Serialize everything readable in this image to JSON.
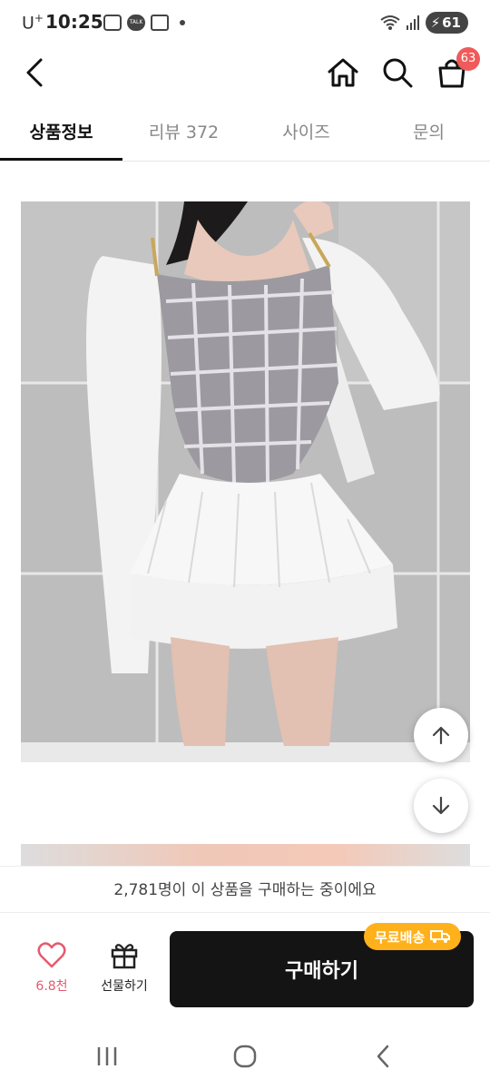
{
  "status_bar": {
    "carrier": "U",
    "carrier_sup": "+",
    "time": "10:25",
    "notification_icons": [
      "gallery-icon",
      "kakaotalk-icon",
      "cart-icon"
    ],
    "talk_label": "TALK",
    "battery": "61"
  },
  "top_bar": {
    "cart_badge": "63"
  },
  "tabs": [
    {
      "label": "상품정보",
      "active": true
    },
    {
      "label": "리뷰 372",
      "active": false
    },
    {
      "label": "사이즈",
      "active": false
    },
    {
      "label": "문의",
      "active": false
    }
  ],
  "purchase_banner": "2,781명이 이 상품을 구매하는 중이에요",
  "actions": {
    "like_count": "6.8천",
    "gift_label": "선물하기",
    "buy_label": "구매하기",
    "free_shipping": "무료배송"
  },
  "colors": {
    "accent_badge": "#f05a5a",
    "like": "#e45b6e",
    "shipping_tag": "#ffb11b",
    "buy_button": "#141414"
  }
}
